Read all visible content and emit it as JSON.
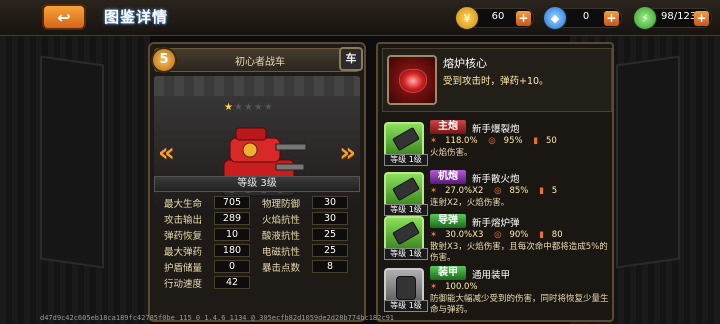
{
  "header": {
    "title": "图鉴详情",
    "back_icon": "return-arrow-icon",
    "resources": {
      "gold": "60",
      "gems": "0",
      "energy": "98/123"
    }
  },
  "vehicle": {
    "rank": "5",
    "name": "初心者战车",
    "type_badge": "车",
    "stars_on": 1,
    "stars_total": 5,
    "level_text": "等级 3级"
  },
  "stats": {
    "hp": {
      "label": "最大生命",
      "value": "705"
    },
    "output": {
      "label": "攻击输出",
      "value": "289"
    },
    "ammo_recover": {
      "label": "弹药恢复",
      "value": "10"
    },
    "max_ammo": {
      "label": "最大弹药",
      "value": "180"
    },
    "shield": {
      "label": "护盾储量",
      "value": "0"
    },
    "speed": {
      "label": "行动速度",
      "value": "42"
    },
    "phys_def": {
      "label": "物理防御",
      "value": "30"
    },
    "fire_res": {
      "label": "火焰抗性",
      "value": "30"
    },
    "acid_res": {
      "label": "酸液抗性",
      "value": "25"
    },
    "elec_res": {
      "label": "电磁抗性",
      "value": "25"
    },
    "crit": {
      "label": "暴击点数",
      "value": "8"
    }
  },
  "core": {
    "name": "熔炉核心",
    "desc": "受到攻击时，弹药+10。"
  },
  "weapons": [
    {
      "type": "主炮",
      "name": "新手爆裂炮",
      "dmg": "118.0%",
      "acc": "95%",
      "ammo": "50",
      "desc": "火焰伤害。",
      "level": "等级 1级"
    },
    {
      "type": "机炮",
      "name": "新手散火炮",
      "dmg": "27.0%X2",
      "acc": "85%",
      "ammo": "5",
      "desc": "连射X2，火焰伤害。",
      "level": "等级 1级"
    },
    {
      "type": "导弹",
      "name": "新手熔炉弹",
      "dmg": "30.0%X3",
      "acc": "90%",
      "ammo": "80",
      "desc": "散射X3，火焰伤害，且每次命中都将造成5%的伤害。",
      "level": "等级 1级"
    },
    {
      "type": "装甲",
      "name": "通用装甲",
      "dmg": "100.0%",
      "acc": "",
      "ammo": "",
      "desc": "防御能大幅减少受到的伤害，同时将恢复少量生命与弹药。",
      "level": "等级 1级"
    }
  ],
  "watermark": "d47d9c42c605eb18ca189fc42785f0be 115 0 1.4.6 1134 @ 305ecfb82d1059de2d28b774bc182c91"
}
